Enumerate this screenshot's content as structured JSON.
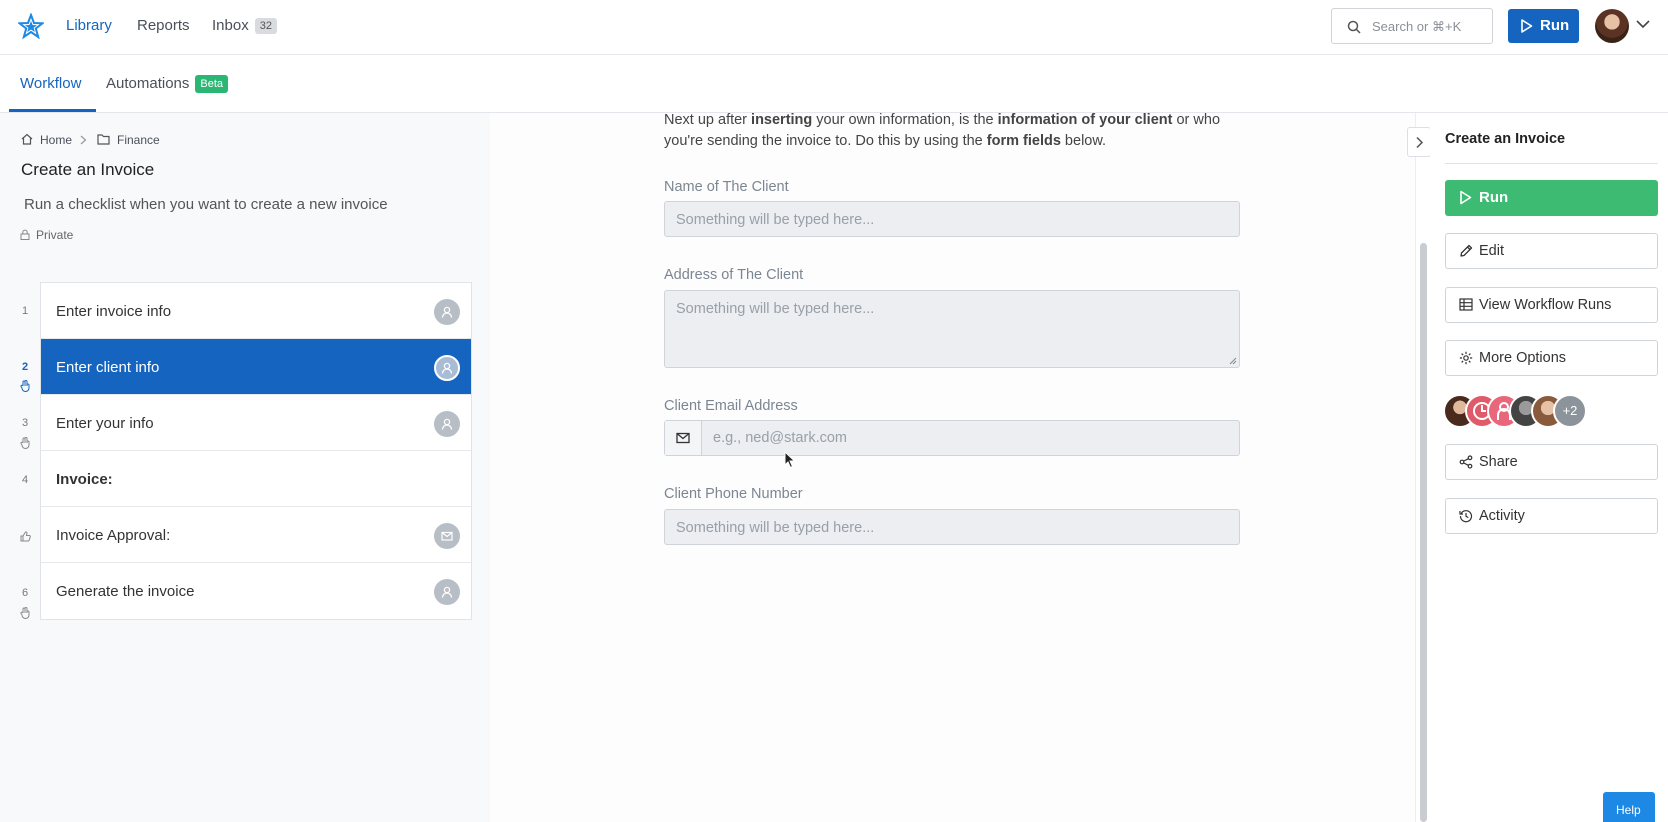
{
  "header": {
    "logo_icon": "star-logo-icon",
    "nav": [
      {
        "label": "Library",
        "active": true
      },
      {
        "label": "Reports",
        "active": false
      },
      {
        "label": "Inbox",
        "active": false
      }
    ],
    "inbox_count": "32",
    "search_placeholder": "Search or ⌘+K",
    "run_label": "Run"
  },
  "subnav": {
    "tabs": [
      {
        "label": "Workflow",
        "active": true
      },
      {
        "label": "Automations",
        "active": false
      }
    ],
    "beta_label": "Beta"
  },
  "sidebar": {
    "breadcrumb": [
      "Home",
      "Finance"
    ],
    "title": "Create an Invoice",
    "description": "Run a checklist when you want to create a new invoice",
    "visibility": "Private",
    "steps": [
      {
        "num": "1",
        "label": "Enter invoice info",
        "icon": "user-icon",
        "active": false,
        "bold": false
      },
      {
        "num": "2",
        "label": "Enter client info",
        "icon": "user-icon",
        "active": true,
        "bold": false
      },
      {
        "num": "3",
        "label": "Enter your info",
        "icon": "user-icon",
        "active": false,
        "bold": false
      },
      {
        "num": "4",
        "label": "Invoice:",
        "icon": "",
        "active": false,
        "bold": true
      },
      {
        "num": "",
        "label": "Invoice Approval:",
        "icon": "mail-icon",
        "active": false,
        "bold": false
      },
      {
        "num": "6",
        "label": "Generate the invoice",
        "icon": "user-icon",
        "active": false,
        "bold": false
      }
    ]
  },
  "main": {
    "intro": {
      "p1": "Next up after ",
      "b1": "inserting",
      "p2": " your own information, is the ",
      "b2": "information of your client",
      "p3": " or who you're sending the invoice to. Do this by using the ",
      "b3": "form fields",
      "p4": " below."
    },
    "fields": {
      "name_label": "Name of The Client",
      "name_placeholder": "Something will be typed here...",
      "address_label": "Address of The Client",
      "address_placeholder": "Something will be typed here...",
      "email_label": "Client Email Address",
      "email_placeholder": "e.g., ned@stark.com",
      "phone_label": "Client Phone Number",
      "phone_placeholder": "Something will be typed here..."
    }
  },
  "right_panel": {
    "title": "Create an Invoice",
    "run_label": "Run",
    "edit_label": "Edit",
    "view_runs_label": "View Workflow Runs",
    "more_options_label": "More Options",
    "assignees_more": "+2",
    "share_label": "Share",
    "activity_label": "Activity"
  },
  "help_label": "Help",
  "colors": {
    "primary": "#1565c0",
    "success": "#3dbb73",
    "beta": "#2bb673"
  }
}
